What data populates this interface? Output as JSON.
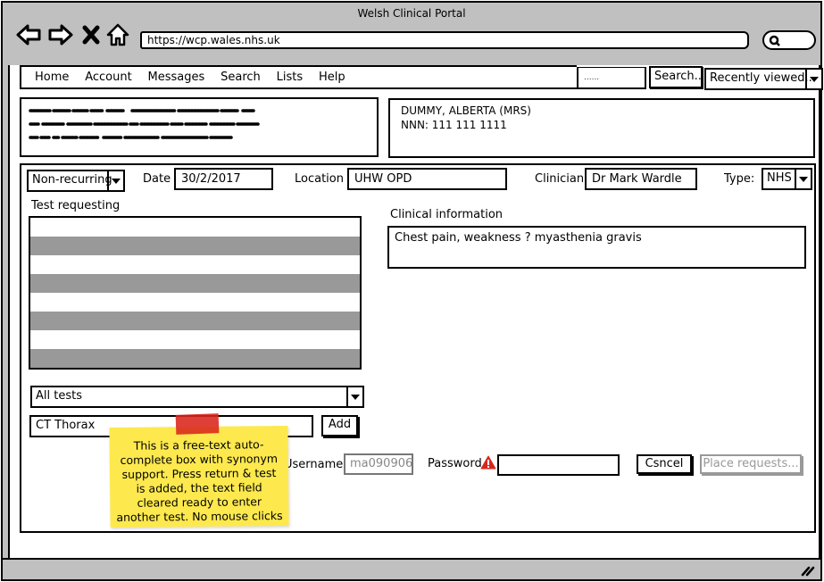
{
  "window": {
    "title": "Welsh Clinical Portal"
  },
  "browser": {
    "url": "https://wcp.wales.nhs.uk",
    "icons": [
      "back-arrow-icon",
      "forward-arrow-icon",
      "stop-icon",
      "home-icon",
      "search-icon"
    ]
  },
  "menu": {
    "items": [
      {
        "label": "Home"
      },
      {
        "label": "Account"
      },
      {
        "label": "Messages"
      },
      {
        "label": "Search"
      },
      {
        "label": "Lists"
      },
      {
        "label": "Help"
      }
    ],
    "search_placeholder": "......",
    "search_button": "Search...",
    "recent_dropdown": "Recently viewed..."
  },
  "patient": {
    "name": "DUMMY, ALBERTA (MRS)",
    "nnn": "NNN: 111 111 1111"
  },
  "form": {
    "recurrence": "Non-recurring",
    "date_label": "Date",
    "date_value": "30/2/2017",
    "location_label": "Location",
    "location_value": "UHW OPD",
    "clinician_label": "Clinician",
    "clinician_value": "Dr Mark Wardle",
    "type_label": "Type:",
    "type_value": "NHS",
    "test_requesting_label": "Test requesting",
    "test_list_rows": 8,
    "clinical_info_label": "Clinical information",
    "clinical_info_value": "Chest pain, weakness ? myasthenia gravis",
    "test_filter": "All tests",
    "test_input_value": "CT Thorax",
    "add_button": "Add",
    "username_label": "Username",
    "username_value": "ma090906",
    "password_label": "Password",
    "password_value": "",
    "cancel_button": "Csncel",
    "place_button": "Place requests..."
  },
  "sticky_note": {
    "lines": [
      "This is a free-text auto-",
      "complete box with synonym",
      "support. Press return & test",
      "is added, the text field",
      "cleared ready to enter",
      "another test. No mouse clicks"
    ]
  },
  "colors": {
    "chrome": "#c0c0c0",
    "stripe": "#999999",
    "sticky": "#fde94e",
    "tape": "#d9261c",
    "warning": "#d9261c",
    "disabled": "#999999"
  }
}
